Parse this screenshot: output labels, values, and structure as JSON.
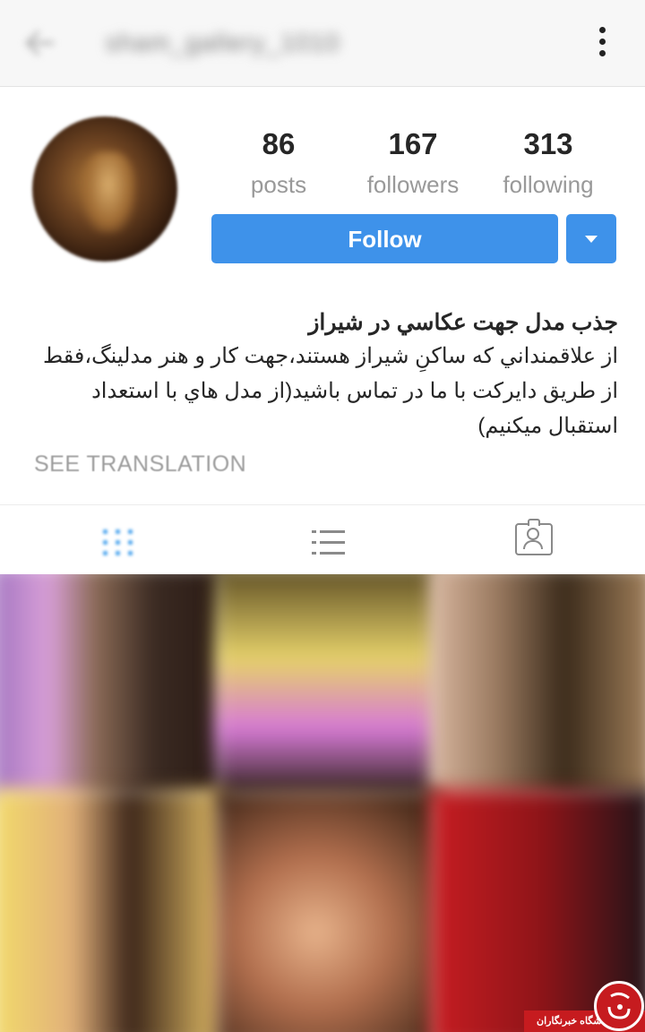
{
  "header": {
    "username": "sham_gallery_1010",
    "back_icon": "arrow-left-icon",
    "more_icon": "more-vertical-icon"
  },
  "profile": {
    "stats": [
      {
        "value": "86",
        "label": "posts"
      },
      {
        "value": "167",
        "label": "followers"
      },
      {
        "value": "313",
        "label": "following"
      }
    ],
    "follow_label": "Follow",
    "dropdown_icon": "chevron-down-icon",
    "accent_color": "#3e92ea"
  },
  "bio": {
    "title": "جذب مدل جهت عكاسي در شيراز",
    "lines": [
      "از علاقمنداني كه ساكنِ شيراز هستند،جهت كار و هنر مدلينگ،فقط",
      "از طريق دايركت با ما در تماس باشيد(از مدل هاي با استعداد",
      "استقبال ميكنيم)"
    ],
    "see_translation": "SEE TRANSLATION"
  },
  "tabs": [
    {
      "name": "grid",
      "icon": "grid-icon",
      "active": true
    },
    {
      "name": "list",
      "icon": "list-icon",
      "active": false
    },
    {
      "name": "tagged",
      "icon": "tagged-person-icon",
      "active": false
    }
  ],
  "watermark": {
    "text": "باشگاه خبرنگاران"
  }
}
